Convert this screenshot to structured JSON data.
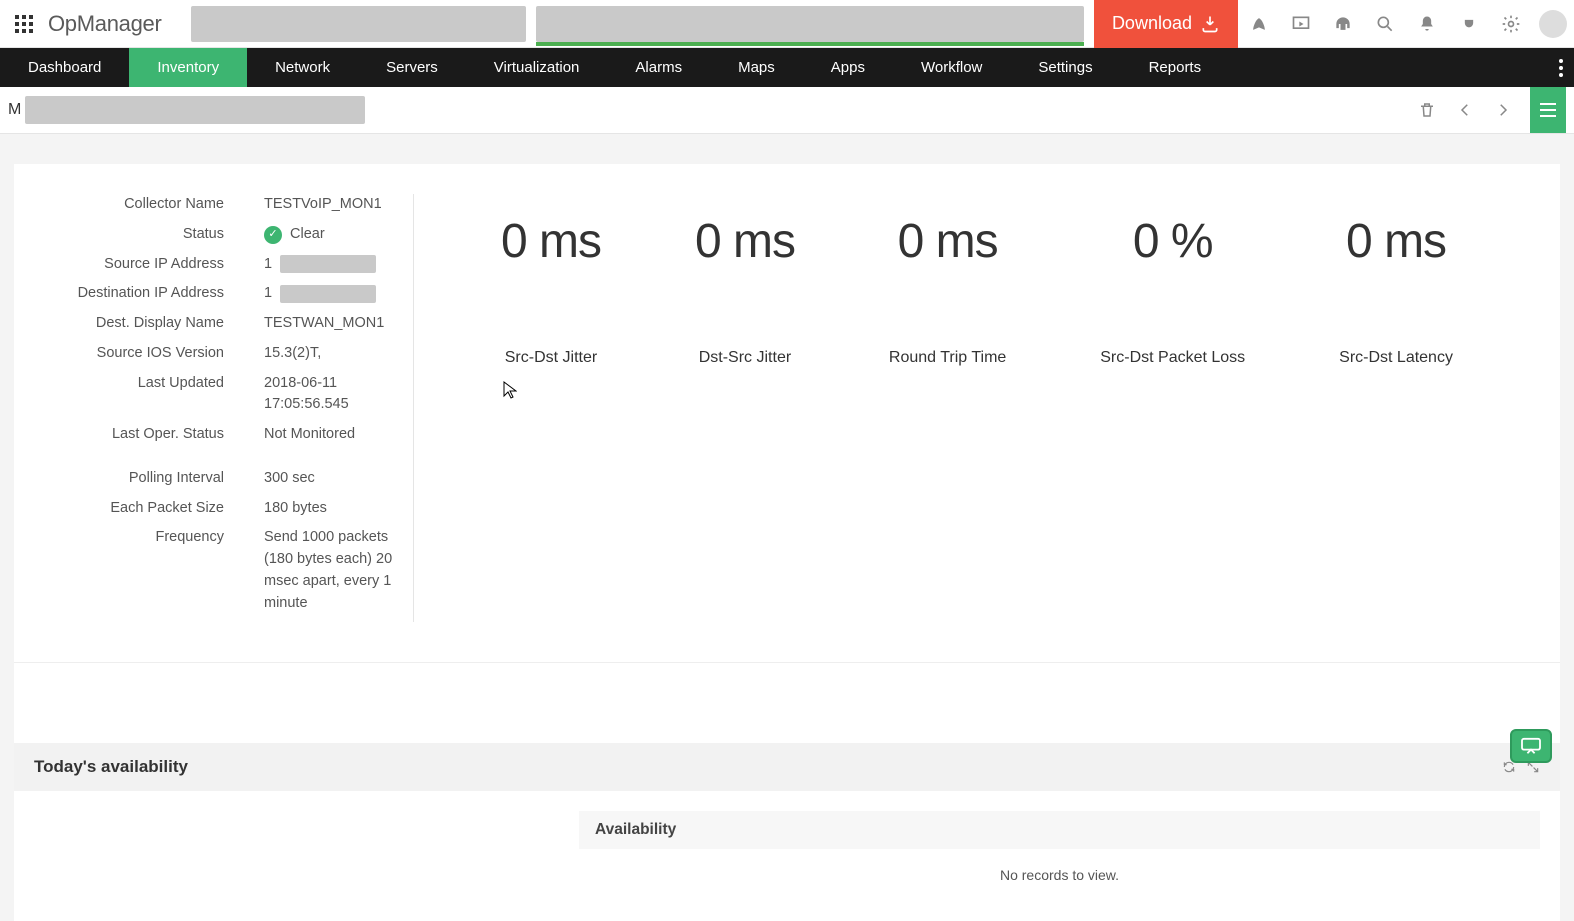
{
  "header": {
    "logo": "OpManager",
    "download_label": "Download"
  },
  "nav": {
    "items": [
      "Dashboard",
      "Inventory",
      "Network",
      "Servers",
      "Virtualization",
      "Alarms",
      "Maps",
      "Apps",
      "Workflow",
      "Settings",
      "Reports"
    ],
    "active_index": 1
  },
  "subheader": {
    "prefix": "M"
  },
  "details": {
    "rows": [
      {
        "label": "Collector Name",
        "value": "TESTVoIP_MON1"
      },
      {
        "label": "Status",
        "value": "Clear",
        "status": true
      },
      {
        "label": "Source IP Address",
        "value": "1",
        "masked": true
      },
      {
        "label": "Destination IP Address",
        "value": "1",
        "masked": true
      },
      {
        "label": "Dest. Display Name",
        "value": "TESTWAN_MON1"
      },
      {
        "label": "Source IOS Version",
        "value": "15.3(2)T,"
      },
      {
        "label": "Last Updated",
        "value": "2018-06-11 17:05:56.545"
      },
      {
        "label": "Last Oper. Status",
        "value": "Not Monitored"
      }
    ],
    "rows2": [
      {
        "label": "Polling Interval",
        "value": "300 sec"
      },
      {
        "label": "Each Packet Size",
        "value": "180 bytes"
      },
      {
        "label": "Frequency",
        "value": "Send 1000 packets (180 bytes each) 20 msec apart, every 1 minute"
      }
    ]
  },
  "metrics": [
    {
      "value": "0 ms",
      "label": "Src-Dst Jitter"
    },
    {
      "value": "0 ms",
      "label": "Dst-Src Jitter"
    },
    {
      "value": "0 ms",
      "label": "Round Trip Time"
    },
    {
      "value": "0 %",
      "label": "Src-Dst Packet Loss"
    },
    {
      "value": "0 ms",
      "label": "Src-Dst Latency"
    }
  ],
  "availability": {
    "title": "Today's availability",
    "sub_title": "Availability",
    "no_records": "No records to view."
  }
}
